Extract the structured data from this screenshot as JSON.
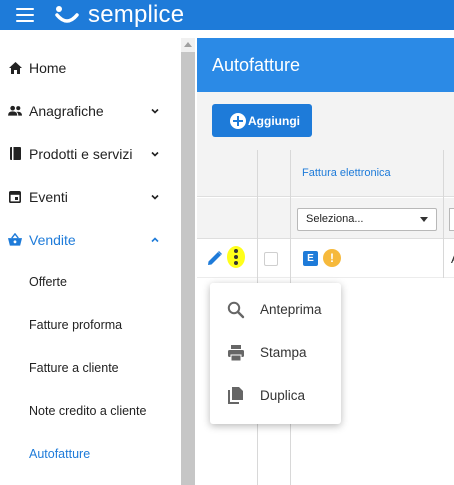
{
  "app": {
    "brand": "semplice"
  },
  "sidebar": {
    "items": [
      {
        "label": "Home",
        "icon": "home-icon"
      },
      {
        "label": "Anagrafiche",
        "icon": "people-icon"
      },
      {
        "label": "Prodotti e servizi",
        "icon": "book-icon"
      },
      {
        "label": "Eventi",
        "icon": "calendar-icon"
      },
      {
        "label": "Vendite",
        "icon": "basket-icon",
        "active": true
      }
    ],
    "subitems": [
      {
        "label": "Offerte"
      },
      {
        "label": "Fatture proforma"
      },
      {
        "label": "Fatture a cliente"
      },
      {
        "label": "Note credito a cliente"
      },
      {
        "label": "Autofatture",
        "active": true
      }
    ]
  },
  "main": {
    "title": "Autofatture",
    "add_label": "Aggiungi",
    "column_title": "Fattura elettronica",
    "filter_placeholder": "Seleziona...",
    "row": {
      "badge": "E",
      "warning": "!",
      "trail": "A"
    }
  },
  "context_menu": {
    "items": [
      {
        "label": "Anteprima",
        "icon": "search-icon"
      },
      {
        "label": "Stampa",
        "icon": "print-icon"
      },
      {
        "label": "Duplica",
        "icon": "copy-icon"
      }
    ]
  },
  "colors": {
    "primary": "#1e7bd9",
    "header": "#2b8ae6",
    "highlight": "#ffff1a",
    "warning": "#f6b93b"
  }
}
